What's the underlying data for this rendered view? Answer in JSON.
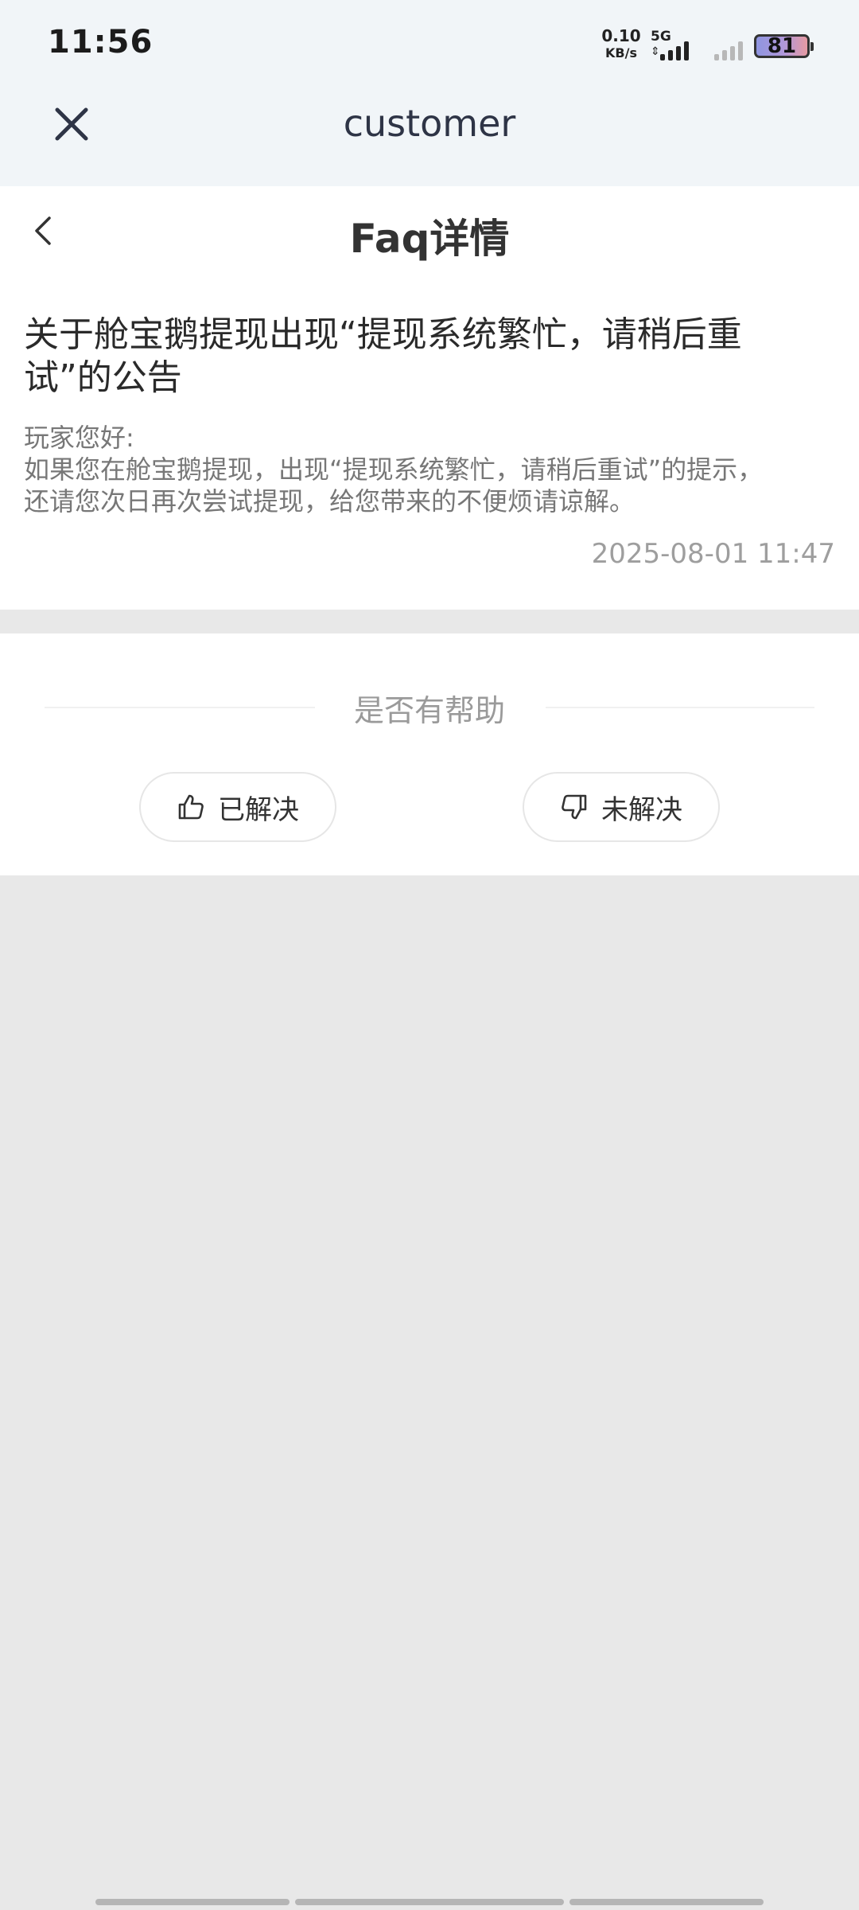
{
  "status_bar": {
    "time": "11:56",
    "net_speed_value": "0.10",
    "net_speed_unit": "KB/s",
    "network_type": "5G",
    "battery_level": "81",
    "icons": [
      "data-arrows-icon",
      "signal-bars-icon",
      "signal-bars-gray-icon",
      "battery-icon"
    ]
  },
  "webview": {
    "title": "customer",
    "close_icon": "close-x-icon"
  },
  "page": {
    "title": "Faq详情",
    "back_icon": "chevron-left-icon"
  },
  "faq": {
    "title_line1": "关于舱宝鹅提现出现“提现系统繁忙，请稍后重",
    "title_line2": "试”的公告",
    "body_line1": "玩家您好:",
    "body_line2": "如果您在舱宝鹅提现，出现“提现系统繁忙，请稍后重试”的提示，",
    "body_line3": "还请您次日再次尝试提现，给您带来的不便烦请谅解。",
    "date": "2025-08-01 11:47"
  },
  "feedback": {
    "question": "是否有帮助",
    "solved_label": "已解决",
    "unsolved_label": "未解决",
    "solved_icon": "thumbs-up-icon",
    "unsolved_icon": "thumbs-down-icon"
  },
  "colors": {
    "top_bg": "#f1f5f8",
    "page_bg": "#e8e8e8",
    "card_bg": "#ffffff",
    "title_text": "#2e3446",
    "muted_text": "#9a9a9a"
  }
}
